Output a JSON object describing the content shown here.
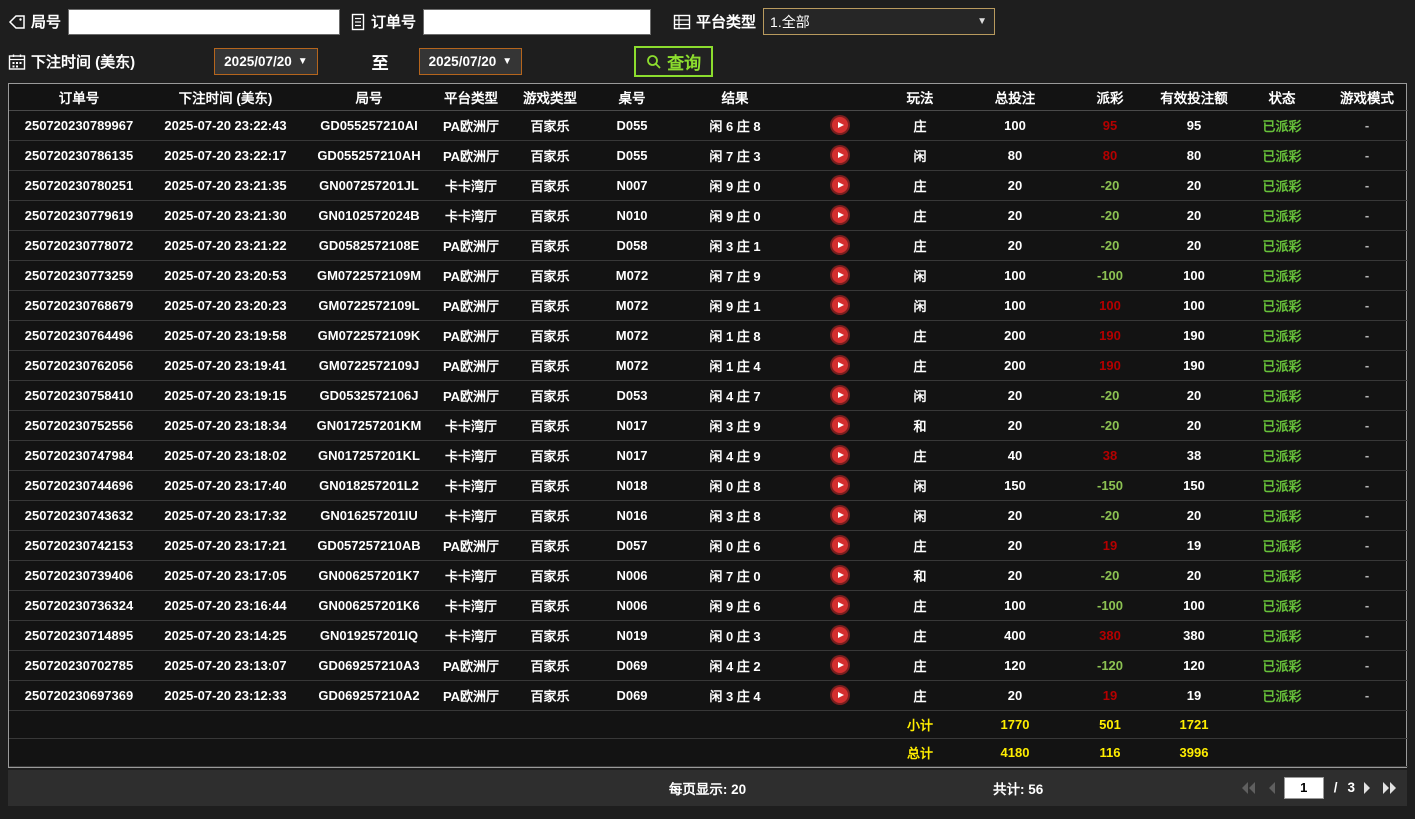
{
  "filters": {
    "round_label": "局号",
    "round_value": "",
    "order_label": "订单号",
    "order_value": "",
    "platform_label": "平台类型",
    "platform_value": "1.全部",
    "bet_time_label": "下注时间 (美东)",
    "date_from": "2025/07/20",
    "to_label": "至",
    "date_to": "2025/07/20",
    "query_label": "查询"
  },
  "table": {
    "headers": {
      "order": "订单号",
      "time": "下注时间 (美东)",
      "round": "局号",
      "platform": "平台类型",
      "game": "游戏类型",
      "table_no": "桌号",
      "result": "结果",
      "video": "",
      "play": "玩法",
      "bet": "总投注",
      "payout": "派彩",
      "valid": "有效投注额",
      "status": "状态",
      "mode": "游戏模式"
    },
    "rows": [
      {
        "order": "250720230789967",
        "time": "2025-07-20 23:22:43",
        "round": "GD055257210AI",
        "platform": "PA欧洲厅",
        "game": "百家乐",
        "table_no": "D055",
        "result": "闲 6 庄 8",
        "play": "庄",
        "bet": "100",
        "payout": "95",
        "valid": "95",
        "status": "已派彩",
        "mode": "-"
      },
      {
        "order": "250720230786135",
        "time": "2025-07-20 23:22:17",
        "round": "GD055257210AH",
        "platform": "PA欧洲厅",
        "game": "百家乐",
        "table_no": "D055",
        "result": "闲 7 庄 3",
        "play": "闲",
        "bet": "80",
        "payout": "80",
        "valid": "80",
        "status": "已派彩",
        "mode": "-"
      },
      {
        "order": "250720230780251",
        "time": "2025-07-20 23:21:35",
        "round": "GN007257201JL",
        "platform": "卡卡湾厅",
        "game": "百家乐",
        "table_no": "N007",
        "result": "闲 9 庄 0",
        "play": "庄",
        "bet": "20",
        "payout": "-20",
        "valid": "20",
        "status": "已派彩",
        "mode": "-"
      },
      {
        "order": "250720230779619",
        "time": "2025-07-20 23:21:30",
        "round": "GN0102572024B",
        "platform": "卡卡湾厅",
        "game": "百家乐",
        "table_no": "N010",
        "result": "闲 9 庄 0",
        "play": "庄",
        "bet": "20",
        "payout": "-20",
        "valid": "20",
        "status": "已派彩",
        "mode": "-"
      },
      {
        "order": "250720230778072",
        "time": "2025-07-20 23:21:22",
        "round": "GD0582572108E",
        "platform": "PA欧洲厅",
        "game": "百家乐",
        "table_no": "D058",
        "result": "闲 3 庄 1",
        "play": "庄",
        "bet": "20",
        "payout": "-20",
        "valid": "20",
        "status": "已派彩",
        "mode": "-"
      },
      {
        "order": "250720230773259",
        "time": "2025-07-20 23:20:53",
        "round": "GM0722572109M",
        "platform": "PA欧洲厅",
        "game": "百家乐",
        "table_no": "M072",
        "result": "闲 7 庄 9",
        "play": "闲",
        "bet": "100",
        "payout": "-100",
        "valid": "100",
        "status": "已派彩",
        "mode": "-"
      },
      {
        "order": "250720230768679",
        "time": "2025-07-20 23:20:23",
        "round": "GM0722572109L",
        "platform": "PA欧洲厅",
        "game": "百家乐",
        "table_no": "M072",
        "result": "闲 9 庄 1",
        "play": "闲",
        "bet": "100",
        "payout": "100",
        "valid": "100",
        "status": "已派彩",
        "mode": "-"
      },
      {
        "order": "250720230764496",
        "time": "2025-07-20 23:19:58",
        "round": "GM0722572109K",
        "platform": "PA欧洲厅",
        "game": "百家乐",
        "table_no": "M072",
        "result": "闲 1 庄 8",
        "play": "庄",
        "bet": "200",
        "payout": "190",
        "valid": "190",
        "status": "已派彩",
        "mode": "-"
      },
      {
        "order": "250720230762056",
        "time": "2025-07-20 23:19:41",
        "round": "GM0722572109J",
        "platform": "PA欧洲厅",
        "game": "百家乐",
        "table_no": "M072",
        "result": "闲 1 庄 4",
        "play": "庄",
        "bet": "200",
        "payout": "190",
        "valid": "190",
        "status": "已派彩",
        "mode": "-"
      },
      {
        "order": "250720230758410",
        "time": "2025-07-20 23:19:15",
        "round": "GD0532572106J",
        "platform": "PA欧洲厅",
        "game": "百家乐",
        "table_no": "D053",
        "result": "闲 4 庄 7",
        "play": "闲",
        "bet": "20",
        "payout": "-20",
        "valid": "20",
        "status": "已派彩",
        "mode": "-"
      },
      {
        "order": "250720230752556",
        "time": "2025-07-20 23:18:34",
        "round": "GN017257201KM",
        "platform": "卡卡湾厅",
        "game": "百家乐",
        "table_no": "N017",
        "result": "闲 3 庄 9",
        "play": "和",
        "bet": "20",
        "payout": "-20",
        "valid": "20",
        "status": "已派彩",
        "mode": "-"
      },
      {
        "order": "250720230747984",
        "time": "2025-07-20 23:18:02",
        "round": "GN017257201KL",
        "platform": "卡卡湾厅",
        "game": "百家乐",
        "table_no": "N017",
        "result": "闲 4 庄 9",
        "play": "庄",
        "bet": "40",
        "payout": "38",
        "valid": "38",
        "status": "已派彩",
        "mode": "-"
      },
      {
        "order": "250720230744696",
        "time": "2025-07-20 23:17:40",
        "round": "GN018257201L2",
        "platform": "卡卡湾厅",
        "game": "百家乐",
        "table_no": "N018",
        "result": "闲 0 庄 8",
        "play": "闲",
        "bet": "150",
        "payout": "-150",
        "valid": "150",
        "status": "已派彩",
        "mode": "-"
      },
      {
        "order": "250720230743632",
        "time": "2025-07-20 23:17:32",
        "round": "GN016257201IU",
        "platform": "卡卡湾厅",
        "game": "百家乐",
        "table_no": "N016",
        "result": "闲 3 庄 8",
        "play": "闲",
        "bet": "20",
        "payout": "-20",
        "valid": "20",
        "status": "已派彩",
        "mode": "-"
      },
      {
        "order": "250720230742153",
        "time": "2025-07-20 23:17:21",
        "round": "GD057257210AB",
        "platform": "PA欧洲厅",
        "game": "百家乐",
        "table_no": "D057",
        "result": "闲 0 庄 6",
        "play": "庄",
        "bet": "20",
        "payout": "19",
        "valid": "19",
        "status": "已派彩",
        "mode": "-"
      },
      {
        "order": "250720230739406",
        "time": "2025-07-20 23:17:05",
        "round": "GN006257201K7",
        "platform": "卡卡湾厅",
        "game": "百家乐",
        "table_no": "N006",
        "result": "闲 7 庄 0",
        "play": "和",
        "bet": "20",
        "payout": "-20",
        "valid": "20",
        "status": "已派彩",
        "mode": "-"
      },
      {
        "order": "250720230736324",
        "time": "2025-07-20 23:16:44",
        "round": "GN006257201K6",
        "platform": "卡卡湾厅",
        "game": "百家乐",
        "table_no": "N006",
        "result": "闲 9 庄 6",
        "play": "庄",
        "bet": "100",
        "payout": "-100",
        "valid": "100",
        "status": "已派彩",
        "mode": "-"
      },
      {
        "order": "250720230714895",
        "time": "2025-07-20 23:14:25",
        "round": "GN019257201IQ",
        "platform": "卡卡湾厅",
        "game": "百家乐",
        "table_no": "N019",
        "result": "闲 0 庄 3",
        "play": "庄",
        "bet": "400",
        "payout": "380",
        "valid": "380",
        "status": "已派彩",
        "mode": "-"
      },
      {
        "order": "250720230702785",
        "time": "2025-07-20 23:13:07",
        "round": "GD069257210A3",
        "platform": "PA欧洲厅",
        "game": "百家乐",
        "table_no": "D069",
        "result": "闲 4 庄 2",
        "play": "庄",
        "bet": "120",
        "payout": "-120",
        "valid": "120",
        "status": "已派彩",
        "mode": "-"
      },
      {
        "order": "250720230697369",
        "time": "2025-07-20 23:12:33",
        "round": "GD069257210A2",
        "platform": "PA欧洲厅",
        "game": "百家乐",
        "table_no": "D069",
        "result": "闲 3 庄 4",
        "play": "庄",
        "bet": "20",
        "payout": "19",
        "valid": "19",
        "status": "已派彩",
        "mode": "-"
      }
    ],
    "subtotal": {
      "label": "小计",
      "bet": "1770",
      "payout": "501",
      "valid": "1721"
    },
    "total": {
      "label": "总计",
      "bet": "4180",
      "payout": "116",
      "valid": "3996"
    }
  },
  "pfooter": {
    "per_page": "每页显示: 20",
    "total_count": "共计: 56",
    "page": "1",
    "page_separator": "/",
    "page_total": "3"
  },
  "colors": {
    "payout_win": "#b40000",
    "payout_loss": "#8cc152",
    "status_green": "#67c23a",
    "summary_yellow": "#ffee00",
    "accent_green": "#8cdd2e",
    "date_border": "#b5651d",
    "dropdown_border": "#b89a5e",
    "play_red": "#d32f2f"
  }
}
